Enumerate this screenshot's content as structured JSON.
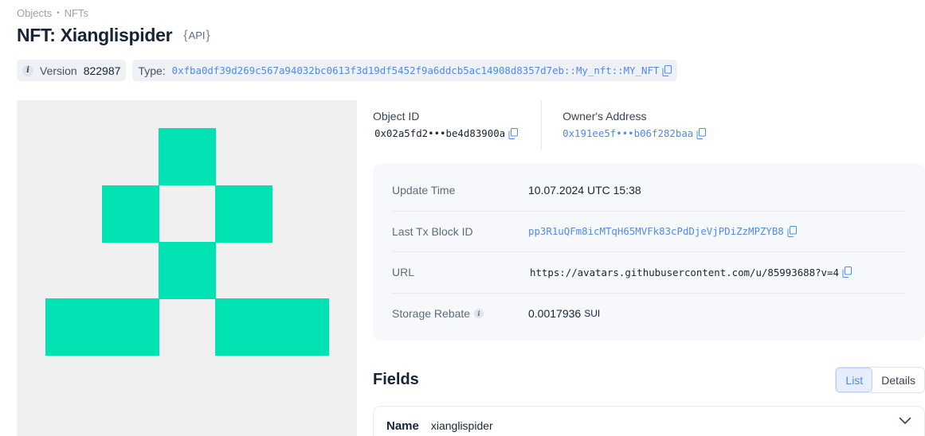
{
  "breadcrumb": {
    "items": [
      "Objects",
      "NFTs"
    ],
    "separator": "•"
  },
  "header": {
    "title": "NFT: Xianglispider",
    "api_label": "API"
  },
  "meta": {
    "version_label": "Version",
    "version_value": "822987",
    "type_label": "Type:",
    "type_value": "0xfba0df39d269c567a94032bc0613f3d19df5452f9a6ddcb5ac14908d8357d7eb::My_nft::MY_NFT"
  },
  "ids": {
    "object_id_label": "Object ID",
    "object_id_value": "0x02a5fd2•••be4d83900a",
    "owner_label": "Owner's Address",
    "owner_value": "0x191ee5f•••b06f282baa"
  },
  "details": {
    "update_time_label": "Update Time",
    "update_time_value": "10.07.2024 UTC 15:38",
    "last_tx_label": "Last Tx Block ID",
    "last_tx_value": "pp3R1uQFm8icMTqH65MVFk83cPdDjeVjPDiZzMPZYB8",
    "url_label": "URL",
    "url_value": "https://avatars.githubusercontent.com/u/85993688?v=4",
    "rebate_label": "Storage Rebate",
    "rebate_value": "0.0017936",
    "rebate_unit": "SUI"
  },
  "fields": {
    "title": "Fields",
    "view_options": [
      "List",
      "Details"
    ],
    "active_view": "List",
    "rows": [
      {
        "name": "Name",
        "value": "xianglispider"
      }
    ]
  },
  "colors": {
    "nft_pixel": "#00e2b2",
    "nft_background": "#f0f0f0",
    "link": "#4d8ce8"
  },
  "icons": [
    "info-icon",
    "copy-icon",
    "chevron-down-icon"
  ]
}
